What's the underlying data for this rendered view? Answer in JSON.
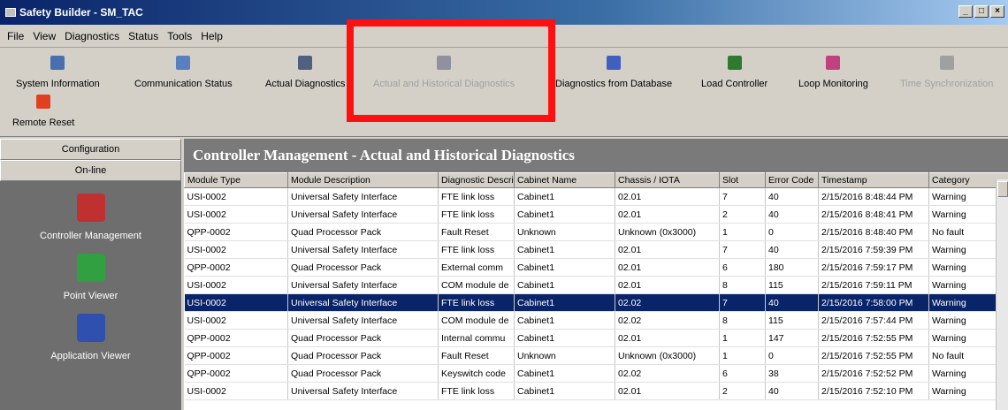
{
  "window": {
    "title": "Safety Builder - SM_TAC"
  },
  "menu": [
    "File",
    "View",
    "Diagnostics",
    "Status",
    "Tools",
    "Help"
  ],
  "toolbar": {
    "buttons": [
      {
        "label": "System Information",
        "icon": "system-information-icon",
        "color": "#4a6fb0",
        "enabled": true
      },
      {
        "label": "Communication Status",
        "icon": "communication-status-icon",
        "color": "#5a7fc0",
        "enabled": true
      },
      {
        "label": "Actual Diagnostics",
        "icon": "actual-diagnostics-icon",
        "color": "#506080",
        "enabled": true
      },
      {
        "label": "Actual and Historical Diagnostics",
        "icon": "historical-diagnostics-icon",
        "color": "#9090a0",
        "enabled": false
      },
      {
        "label": "Diagnostics from Database",
        "icon": "database-diagnostics-icon",
        "color": "#4060c0",
        "enabled": true
      },
      {
        "label": "Load Controller",
        "icon": "load-controller-icon",
        "color": "#2f7a2f",
        "enabled": true
      },
      {
        "label": "Loop Monitoring",
        "icon": "loop-monitoring-icon",
        "color": "#c04080",
        "enabled": true
      },
      {
        "label": "Time Synchronization",
        "icon": "time-sync-icon",
        "color": "#a0a0a0",
        "enabled": false
      }
    ],
    "remote_reset": {
      "label": "Remote Reset",
      "icon": "remote-reset-icon",
      "color": "#e04020"
    }
  },
  "left_panel": {
    "tabs": [
      "Configuration",
      "On-line"
    ],
    "items": [
      {
        "label": "Controller Management",
        "icon": "controller-management-icon",
        "color": "#c03030"
      },
      {
        "label": "Point Viewer",
        "icon": "point-viewer-icon",
        "color": "#30a040"
      },
      {
        "label": "Application Viewer",
        "icon": "application-viewer-icon",
        "color": "#3050b0"
      }
    ]
  },
  "main": {
    "header": "Controller Management - Actual and Historical Diagnostics",
    "columns": [
      "Module Type",
      "Module Description",
      "Diagnostic Description",
      "Cabinet Name",
      "Chassis / IOTA",
      "Slot",
      "Error Code",
      "Timestamp",
      "Category"
    ],
    "rows": [
      [
        "USI-0002",
        "Universal Safety Interface",
        "FTE link loss",
        "Cabinet1",
        "02.01",
        "7",
        "40",
        "2/15/2016 8:48:44 PM",
        "Warning"
      ],
      [
        "USI-0002",
        "Universal Safety Interface",
        "FTE link loss",
        "Cabinet1",
        "02.01",
        "2",
        "40",
        "2/15/2016 8:48:41 PM",
        "Warning"
      ],
      [
        "QPP-0002",
        "Quad Processor Pack",
        "Fault Reset",
        "Unknown",
        "Unknown (0x3000)",
        "1",
        "0",
        "2/15/2016 8:48:40 PM",
        "No fault"
      ],
      [
        "USI-0002",
        "Universal Safety Interface",
        "FTE link loss",
        "Cabinet1",
        "02.01",
        "7",
        "40",
        "2/15/2016 7:59:39 PM",
        "Warning"
      ],
      [
        "QPP-0002",
        "Quad Processor Pack",
        "External comm",
        "Cabinet1",
        "02.01",
        "6",
        "180",
        "2/15/2016 7:59:17 PM",
        "Warning"
      ],
      [
        "USI-0002",
        "Universal Safety Interface",
        "COM module de",
        "Cabinet1",
        "02.01",
        "8",
        "115",
        "2/15/2016 7:59:11 PM",
        "Warning"
      ],
      [
        "USI-0002",
        "Universal Safety Interface",
        "FTE link loss",
        "Cabinet1",
        "02.02",
        "7",
        "40",
        "2/15/2016 7:58:00 PM",
        "Warning"
      ],
      [
        "USI-0002",
        "Universal Safety Interface",
        "COM module de",
        "Cabinet1",
        "02.02",
        "8",
        "115",
        "2/15/2016 7:57:44 PM",
        "Warning"
      ],
      [
        "QPP-0002",
        "Quad Processor Pack",
        "Internal commu",
        "Cabinet1",
        "02.01",
        "1",
        "147",
        "2/15/2016 7:52:55 PM",
        "Warning"
      ],
      [
        "QPP-0002",
        "Quad Processor Pack",
        "Fault Reset",
        "Unknown",
        "Unknown (0x3000)",
        "1",
        "0",
        "2/15/2016 7:52:55 PM",
        "No fault"
      ],
      [
        "QPP-0002",
        "Quad Processor Pack",
        "Keyswitch code",
        "Cabinet1",
        "02.02",
        "6",
        "38",
        "2/15/2016 7:52:52 PM",
        "Warning"
      ],
      [
        "USI-0002",
        "Universal Safety Interface",
        "FTE link loss",
        "Cabinet1",
        "02.01",
        "2",
        "40",
        "2/15/2016 7:52:10 PM",
        "Warning"
      ]
    ],
    "selected_row": 6
  }
}
